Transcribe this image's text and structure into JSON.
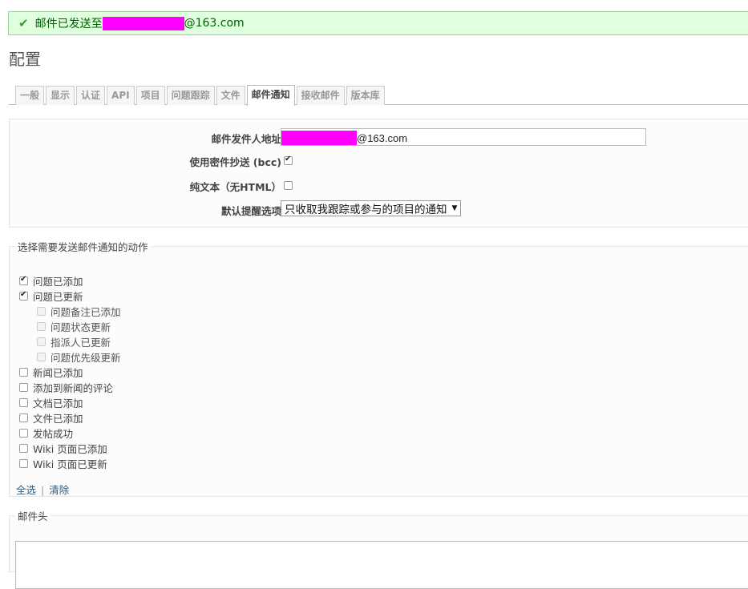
{
  "flash": {
    "prefix": "邮件已发送至",
    "suffix": "@163.com",
    "icon": "check-icon",
    "color": "#dfffdf"
  },
  "page": {
    "title": "配置"
  },
  "tabs": [
    {
      "label": "一般"
    },
    {
      "label": "显示"
    },
    {
      "label": "认证"
    },
    {
      "label": "API"
    },
    {
      "label": "项目"
    },
    {
      "label": "问题跟踪"
    },
    {
      "label": "文件"
    },
    {
      "label": "邮件通知",
      "selected": true
    },
    {
      "label": "接收邮件"
    },
    {
      "label": "版本库"
    }
  ],
  "settings": {
    "sender_label": "邮件发件人地址",
    "sender_value_suffix": "@163.com",
    "bcc_label": "使用密件抄送 (bcc)",
    "bcc_checked": true,
    "plain_label": "纯文本（无HTML）",
    "plain_checked": false,
    "default_notify_label": "默认提醒选项",
    "default_notify_value": "只收取我跟踪或参与的项目的通知"
  },
  "actions_section": {
    "legend": "选择需要发送邮件通知的动作",
    "items": [
      {
        "label": "问题已添加",
        "checked": true,
        "sub": false,
        "disabled": false
      },
      {
        "label": "问题已更新",
        "checked": true,
        "sub": false,
        "disabled": false
      },
      {
        "label": "问题备注已添加",
        "checked": false,
        "sub": true,
        "disabled": true
      },
      {
        "label": "问题状态更新",
        "checked": false,
        "sub": true,
        "disabled": true
      },
      {
        "label": "指派人已更新",
        "checked": false,
        "sub": true,
        "disabled": true
      },
      {
        "label": "问题优先级更新",
        "checked": false,
        "sub": true,
        "disabled": true
      },
      {
        "label": "新闻已添加",
        "checked": false,
        "sub": false,
        "disabled": false
      },
      {
        "label": "添加到新闻的评论",
        "checked": false,
        "sub": false,
        "disabled": false
      },
      {
        "label": "文档已添加",
        "checked": false,
        "sub": false,
        "disabled": false
      },
      {
        "label": "文件已添加",
        "checked": false,
        "sub": false,
        "disabled": false
      },
      {
        "label": "发帖成功",
        "checked": false,
        "sub": false,
        "disabled": false
      },
      {
        "label": "Wiki 页面已添加",
        "checked": false,
        "sub": false,
        "disabled": false
      },
      {
        "label": "Wiki 页面已更新",
        "checked": false,
        "sub": false,
        "disabled": false
      }
    ],
    "select_all": "全选",
    "separator": "|",
    "clear": "清除"
  },
  "header_section": {
    "legend": "邮件头"
  }
}
